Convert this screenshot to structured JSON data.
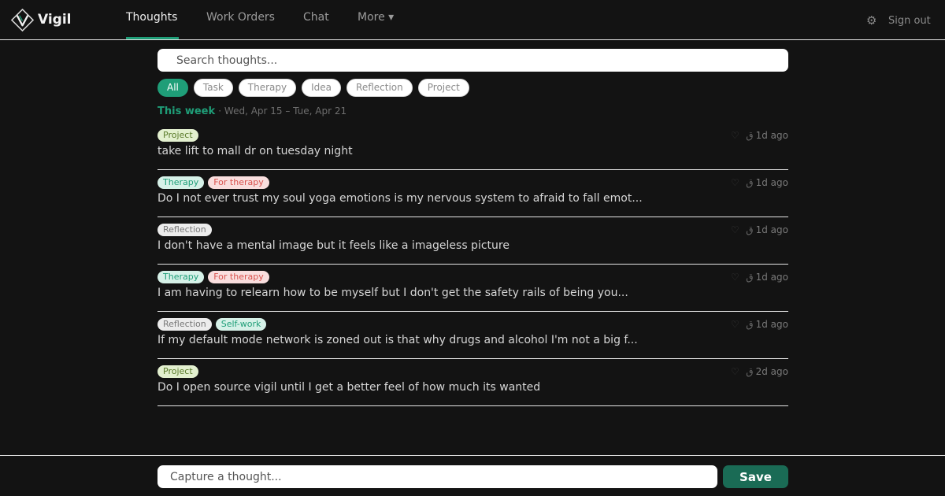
{
  "brand": {
    "name": "Vigil"
  },
  "nav": {
    "tabs": [
      {
        "label": "Thoughts"
      },
      {
        "label": "Work Orders"
      },
      {
        "label": "Chat"
      },
      {
        "label": "More ▾"
      }
    ],
    "active_tab": "Thoughts",
    "settings_icon": "gear-icon",
    "sign_out_label": "Sign out"
  },
  "search": {
    "placeholder": "Search thoughts..."
  },
  "filters": [
    {
      "label": "All",
      "active": true
    },
    {
      "label": "Task",
      "active": false
    },
    {
      "label": "Therapy",
      "active": false
    },
    {
      "label": "Idea",
      "active": false
    },
    {
      "label": "Reflection",
      "active": false
    },
    {
      "label": "Project",
      "active": false
    }
  ],
  "week": {
    "label": "This week",
    "range": "· Wed, Apr 15 – Tue, Apr 21"
  },
  "tag_colors": {
    "Project": {
      "bg": "#e3f0cf",
      "fg": "#5a7a2a"
    },
    "Therapy": {
      "bg": "#d6f1e8",
      "fg": "#1f9e78"
    },
    "For therapy": {
      "bg": "#f9dede",
      "fg": "#d9534f"
    },
    "Reflection": {
      "bg": "#ececec",
      "fg": "#777777"
    },
    "Self-work": {
      "bg": "#d6f1e8",
      "fg": "#1f9e78"
    }
  },
  "thoughts": [
    {
      "tags": [
        "Project"
      ],
      "text": "take lift to mall dr on tuesday night",
      "swipe": "ق",
      "time": "1d ago"
    },
    {
      "tags": [
        "Therapy",
        "For therapy"
      ],
      "text": "Do I not ever trust my soul yoga emotions is my nervous system to afraid to fall emot...",
      "swipe": "ق",
      "time": "1d ago"
    },
    {
      "tags": [
        "Reflection"
      ],
      "text": "I don't have a mental image but it feels like a imageless picture",
      "swipe": "ق",
      "time": "1d ago"
    },
    {
      "tags": [
        "Therapy",
        "For therapy"
      ],
      "text": "I am having to relearn how to be myself but I don't get the safety rails of being you...",
      "swipe": "ق",
      "time": "1d ago"
    },
    {
      "tags": [
        "Reflection",
        "Self-work"
      ],
      "text": "If my default mode network is zoned out is that why drugs and alcohol I'm not a big f...",
      "swipe": "ق",
      "time": "1d ago"
    },
    {
      "tags": [
        "Project"
      ],
      "text": "Do I open source vigil until I get a better feel of how much its wanted",
      "swipe": "ق",
      "time": "2d ago"
    }
  ],
  "heart_icon": "heart-icon",
  "heart_glyph": "♡",
  "capture": {
    "placeholder": "Capture a thought...",
    "save_label": "Save"
  }
}
